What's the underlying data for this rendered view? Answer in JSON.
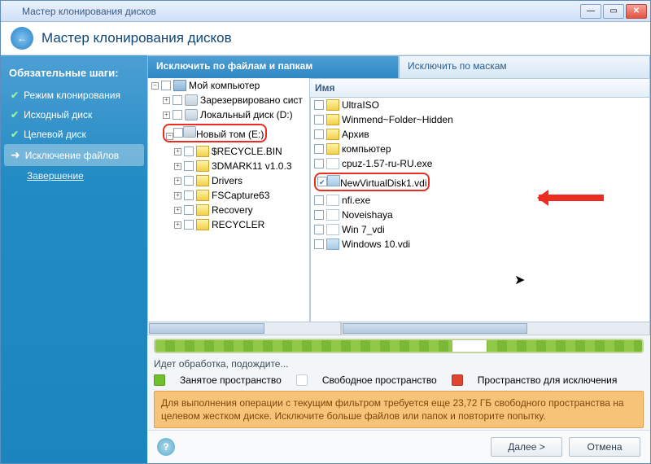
{
  "window": {
    "title": "Мастер клонирования дисков"
  },
  "header": {
    "title": "Мастер клонирования дисков"
  },
  "sidebar": {
    "heading": "Обязательные шаги:",
    "steps": [
      {
        "label": "Режим клонирования",
        "state": "done"
      },
      {
        "label": "Исходный диск",
        "state": "done"
      },
      {
        "label": "Целевой диск",
        "state": "done"
      },
      {
        "label": "Исключение файлов",
        "state": "current"
      },
      {
        "label": "Завершение",
        "state": "pending"
      }
    ]
  },
  "tabs": {
    "files": "Исключить по файлам и папкам",
    "masks": "Исключить по маскам"
  },
  "list_header": "Имя",
  "tree": [
    {
      "label": "Мой компьютер",
      "icon": "computer",
      "indent": 0,
      "exp": "minus",
      "chk": false
    },
    {
      "label": "Зарезервировано сист",
      "icon": "disk",
      "indent": 1,
      "exp": "plus",
      "chk": false
    },
    {
      "label": "Локальный диск (D:)",
      "icon": "disk",
      "indent": 1,
      "exp": "plus",
      "chk": false
    },
    {
      "label": "Новый том (E:)",
      "icon": "disk",
      "indent": 1,
      "exp": "minus",
      "chk": false,
      "highlight": true
    },
    {
      "label": "$RECYCLE.BIN",
      "icon": "folder",
      "indent": 2,
      "exp": "plus",
      "chk": false
    },
    {
      "label": "3DMARK11 v1.0.3",
      "icon": "folder",
      "indent": 2,
      "exp": "plus",
      "chk": false
    },
    {
      "label": "Drivers",
      "icon": "folder",
      "indent": 2,
      "exp": "plus",
      "chk": false
    },
    {
      "label": "FSCapture63",
      "icon": "folder",
      "indent": 2,
      "exp": "plus",
      "chk": false
    },
    {
      "label": "Recovery",
      "icon": "folder",
      "indent": 2,
      "exp": "plus",
      "chk": false
    },
    {
      "label": "RECYCLER",
      "icon": "folder",
      "indent": 2,
      "exp": "plus",
      "chk": false
    }
  ],
  "files": [
    {
      "label": "UltraISO",
      "icon": "folder",
      "chk": false
    },
    {
      "label": "Winmend~Folder~Hidden",
      "icon": "folder",
      "chk": false
    },
    {
      "label": "Архив",
      "icon": "folder",
      "chk": false
    },
    {
      "label": "компьютер",
      "icon": "folder",
      "chk": false
    },
    {
      "label": "cpuz-1.57-ru-RU.exe",
      "icon": "file",
      "chk": false
    },
    {
      "label": "NewVirtualDisk1.vdi",
      "icon": "cfile",
      "chk": true,
      "highlight": true
    },
    {
      "label": "nfi.exe",
      "icon": "file",
      "chk": false
    },
    {
      "label": "Noveishaya",
      "icon": "file",
      "chk": false
    },
    {
      "label": "Win 7_vdi",
      "icon": "file",
      "chk": false
    },
    {
      "label": "Windows 10.vdi",
      "icon": "cfile",
      "chk": false
    }
  ],
  "status": "Идет обработка, подождите...",
  "legend": {
    "used": "Занятое пространство",
    "free": "Свободное пространство",
    "excl": "Пространство для исключения"
  },
  "warning": "Для выполнения операции с текущим фильтром требуется еще 23,72 ГБ свободного пространства на целевом жестком диске. Исключите больше файлов или папок и повторите попытку.",
  "buttons": {
    "next": "Далее >",
    "cancel": "Отмена"
  }
}
